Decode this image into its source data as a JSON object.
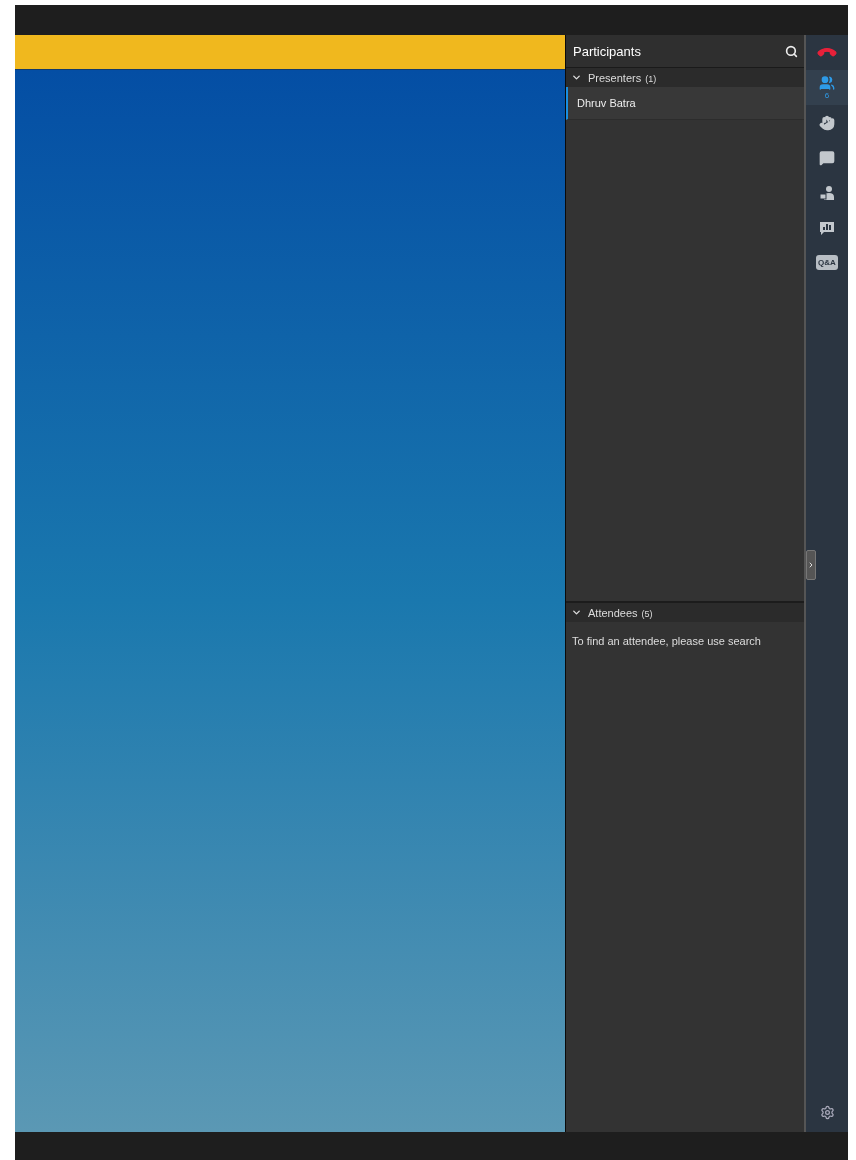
{
  "panel": {
    "title": "Participants",
    "sections": [
      {
        "title": "Presenters",
        "count": "(1)",
        "expanded": true,
        "people": [
          {
            "name": "Dhruv Batra",
            "selected": true
          }
        ]
      },
      {
        "title": "Attendees",
        "count": "(5)",
        "expanded": true,
        "hint": "To find an attendee, please use search"
      }
    ]
  },
  "rail": {
    "items": [
      {
        "kind": "hangup",
        "selected": false
      },
      {
        "kind": "participants",
        "badge": "6",
        "selected": true
      },
      {
        "kind": "hand",
        "selected": false
      },
      {
        "kind": "chat",
        "selected": false
      },
      {
        "kind": "presenter",
        "selected": false
      },
      {
        "kind": "poll",
        "selected": false
      },
      {
        "kind": "qa",
        "label": "Q&A",
        "selected": false
      }
    ]
  }
}
